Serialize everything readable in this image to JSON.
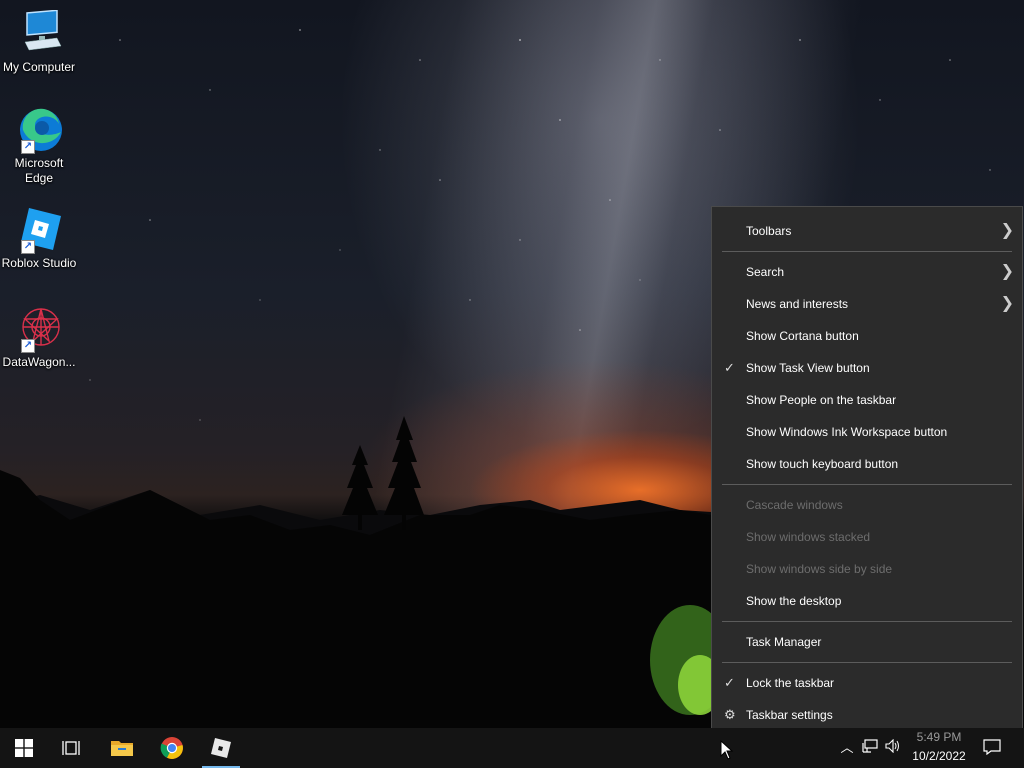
{
  "desktop": {
    "icons": [
      {
        "label": "My Computer",
        "icon": "computer-icon"
      },
      {
        "label": "Microsoft Edge",
        "icon": "edge-icon"
      },
      {
        "label": "Roblox Studio",
        "icon": "roblox-studio-icon"
      },
      {
        "label": "DataWagon...",
        "icon": "datawagon-icon"
      }
    ]
  },
  "context_menu": {
    "items": [
      {
        "label": "Toolbars",
        "submenu": true
      },
      {
        "label": "Search",
        "submenu": true
      },
      {
        "label": "News and interests",
        "submenu": true
      },
      {
        "label": "Show Cortana button"
      },
      {
        "label": "Show Task View button",
        "checked": true
      },
      {
        "label": "Show People on the taskbar"
      },
      {
        "label": "Show Windows Ink Workspace button"
      },
      {
        "label": "Show touch keyboard button"
      },
      {
        "label": "Cascade windows",
        "disabled": true
      },
      {
        "label": "Show windows stacked",
        "disabled": true
      },
      {
        "label": "Show windows side by side",
        "disabled": true
      },
      {
        "label": "Show the desktop"
      },
      {
        "label": "Task Manager"
      },
      {
        "label": "Lock the taskbar",
        "checked": true
      },
      {
        "label": "Taskbar settings",
        "icon": "gear-icon"
      }
    ]
  },
  "taskbar": {
    "pinned": [
      {
        "name": "start-button",
        "icon": "windows-logo-icon"
      },
      {
        "name": "task-view-button",
        "icon": "task-view-icon"
      },
      {
        "name": "file-explorer-button",
        "icon": "folder-icon"
      },
      {
        "name": "chrome-button",
        "icon": "chrome-icon"
      },
      {
        "name": "roblox-button",
        "icon": "roblox-icon",
        "active": true
      }
    ],
    "tray": {
      "time": "5:49 PM",
      "date": "10/2/2022"
    },
    "accent_color": "#76b9ed"
  },
  "colors": {
    "menu_background": "#2b2b2b",
    "menu_text": "#ffffff",
    "menu_disabled_text": "#6d6d6d",
    "taskbar_background": "#141414"
  }
}
